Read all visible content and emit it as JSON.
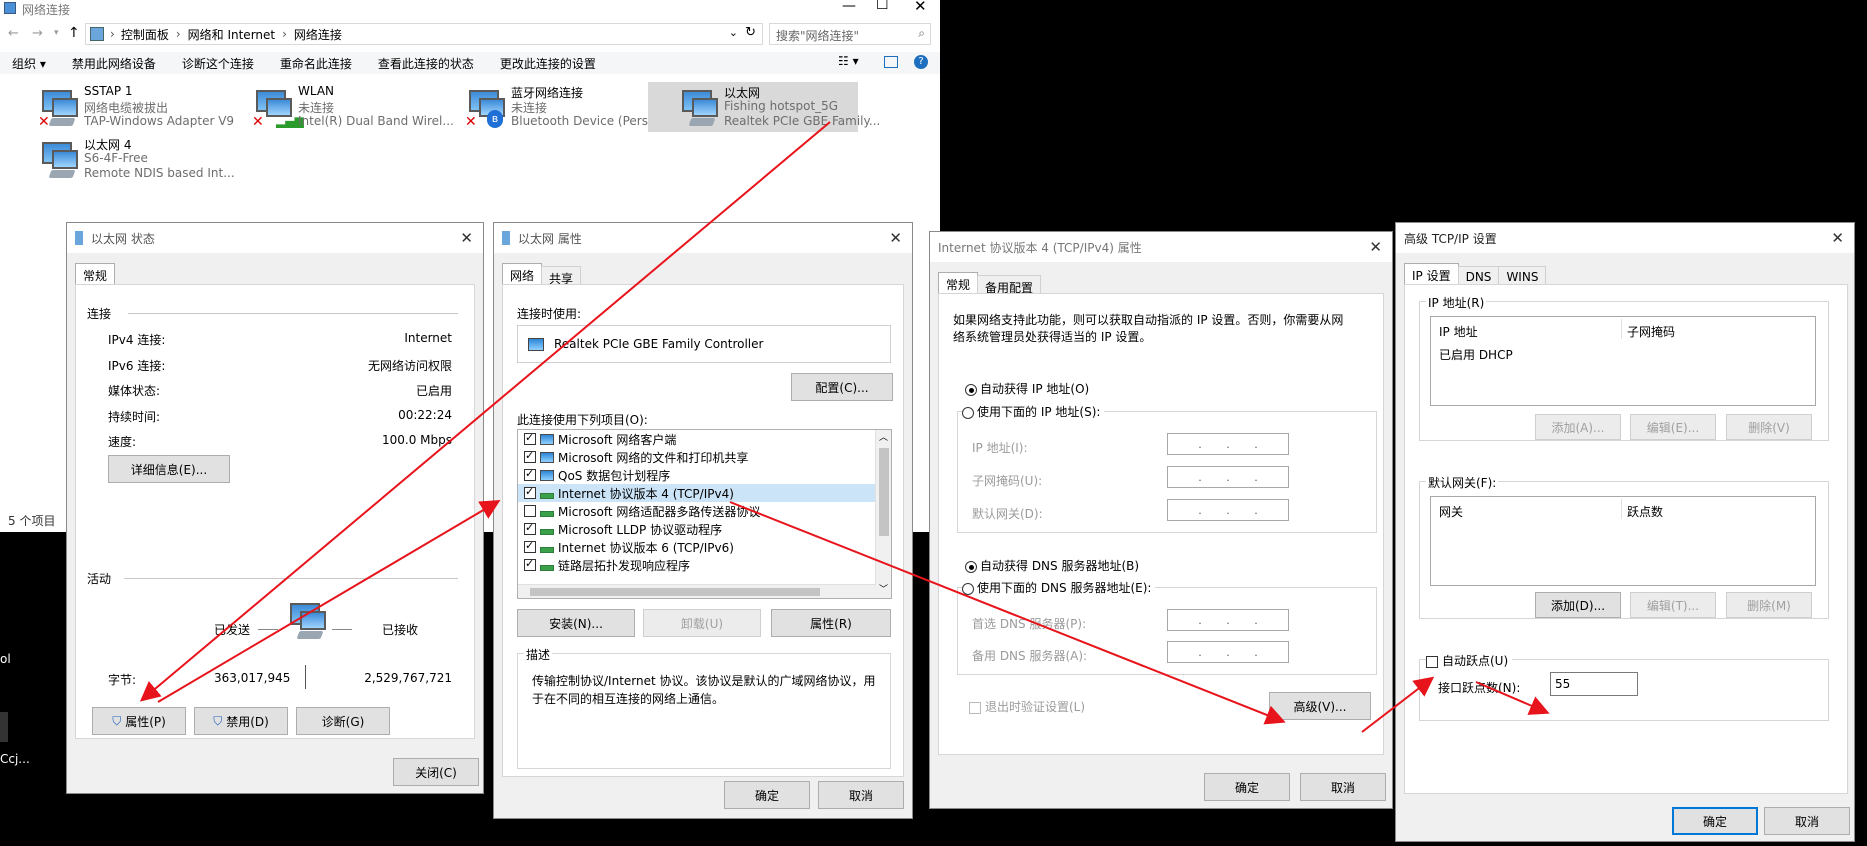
{
  "explorer": {
    "title": "网络连接",
    "breadcrumb": [
      "控制面板",
      "网络和 Internet",
      "网络连接"
    ],
    "search_placeholder": "搜索\"网络连接\"",
    "commands": [
      "组织 ▾",
      "禁用此网络设备",
      "诊断这个连接",
      "重命名此连接",
      "查看此连接的状态",
      "更改此连接的设置"
    ],
    "status": "5 个项目",
    "connections": [
      {
        "name": "SSTAP 1",
        "status": "网络电缆被拔出",
        "device": "TAP-Windows Adapter V9"
      },
      {
        "name": "WLAN",
        "status": "未连接",
        "device": "Intel(R) Dual Band Wirel..."
      },
      {
        "name": "蓝牙网络连接",
        "status": "未连接",
        "device": "Bluetooth Device (Perso..."
      },
      {
        "name": "以太网",
        "status": "Fishing hotspot_5G",
        "device": "Realtek PCIe GBE Family..."
      },
      {
        "name": "以太网 4",
        "status": "S6-4F-Free",
        "device": "Remote NDIS based Int..."
      }
    ]
  },
  "left_edge": {
    "a": "ol",
    "b": "Ccj..."
  },
  "status_dialog": {
    "title": "以太网 状态",
    "tab": "常规",
    "section_connection": "连接",
    "rows": [
      {
        "label": "IPv4 连接:",
        "value": "Internet"
      },
      {
        "label": "IPv6 连接:",
        "value": "无网络访问权限"
      },
      {
        "label": "媒体状态:",
        "value": "已启用"
      },
      {
        "label": "持续时间:",
        "value": "00:22:24"
      },
      {
        "label": "速度:",
        "value": "100.0 Mbps"
      }
    ],
    "details_button": "详细信息(E)...",
    "section_activity": "活动",
    "sent_label": "已发送",
    "received_label": "已接收",
    "bytes_label": "字节:",
    "bytes_sent": "363,017,945",
    "bytes_received": "2,529,767,721",
    "properties_button": "属性(P)",
    "disable_button": "禁用(D)",
    "diagnose_button": "诊断(G)",
    "close_button": "关闭(C)"
  },
  "props_dialog": {
    "title": "以太网 属性",
    "tabs": [
      "网络",
      "共享"
    ],
    "connect_using_label": "连接时使用:",
    "adapter": "Realtek PCIe GBE Family Controller",
    "configure_button": "配置(C)...",
    "items_label": "此连接使用下列项目(O):",
    "items": [
      {
        "checked": true,
        "label": "Microsoft 网络客户端"
      },
      {
        "checked": true,
        "label": "Microsoft 网络的文件和打印机共享"
      },
      {
        "checked": true,
        "label": "QoS 数据包计划程序"
      },
      {
        "checked": true,
        "label": "Internet 协议版本 4 (TCP/IPv4)"
      },
      {
        "checked": false,
        "label": "Microsoft 网络适配器多路传送器协议"
      },
      {
        "checked": true,
        "label": "Microsoft LLDP 协议驱动程序"
      },
      {
        "checked": true,
        "label": "Internet 协议版本 6 (TCP/IPv6)"
      },
      {
        "checked": true,
        "label": "链路层拓扑发现响应程序"
      }
    ],
    "install_button": "安装(N)...",
    "uninstall_button": "卸载(U)",
    "properties_button": "属性(R)",
    "description_label": "描述",
    "description": "传输控制协议/Internet 协议。该协议是默认的广域网络协议，用于在不同的相互连接的网络上通信。",
    "ok_button": "确定",
    "cancel_button": "取消"
  },
  "ipv4_dialog": {
    "title": "Internet 协议版本 4 (TCP/IPv4) 属性",
    "tabs": [
      "常规",
      "备用配置"
    ],
    "intro": "如果网络支持此功能，则可以获取自动指派的 IP 设置。否则，你需要从网络系统管理员处获得适当的 IP 设置。",
    "auto_ip": "自动获得 IP 地址(O)",
    "manual_ip": "使用下面的 IP 地址(S):",
    "ip_label": "IP 地址(I):",
    "mask_label": "子网掩码(U):",
    "gateway_label": "默认网关(D):",
    "auto_dns": "自动获得 DNS 服务器地址(B)",
    "manual_dns": "使用下面的 DNS 服务器地址(E):",
    "preferred_dns": "首选 DNS 服务器(P):",
    "alternate_dns": "备用 DNS 服务器(A):",
    "validate": "退出时验证设置(L)",
    "advanced_button": "高级(V)...",
    "ok_button": "确定",
    "cancel_button": "取消",
    "ip_dots": ". . ."
  },
  "adv_dialog": {
    "title": "高级 TCP/IP 设置",
    "tabs": [
      "IP 设置",
      "DNS",
      "WINS"
    ],
    "ip_section": "IP 地址(R)",
    "col_ip": "IP 地址",
    "col_mask": "子网掩码",
    "dhcp_row": "已启用 DHCP",
    "add1": "添加(A)...",
    "edit1": "编辑(E)...",
    "remove1": "删除(V)",
    "gw_section": "默认网关(F):",
    "col_gw": "网关",
    "col_metric": "跃点数",
    "add2": "添加(D)...",
    "edit2": "编辑(T)...",
    "remove2": "删除(M)",
    "auto_metric": "自动跃点(U)",
    "metric_label": "接口跃点数(N):",
    "metric_value": "55",
    "ok_button": "确定",
    "cancel_button": "取消"
  },
  "colors": {
    "arrow": "#e8141c",
    "accent": "#0078d7",
    "selected_item": "#cce4f7"
  }
}
